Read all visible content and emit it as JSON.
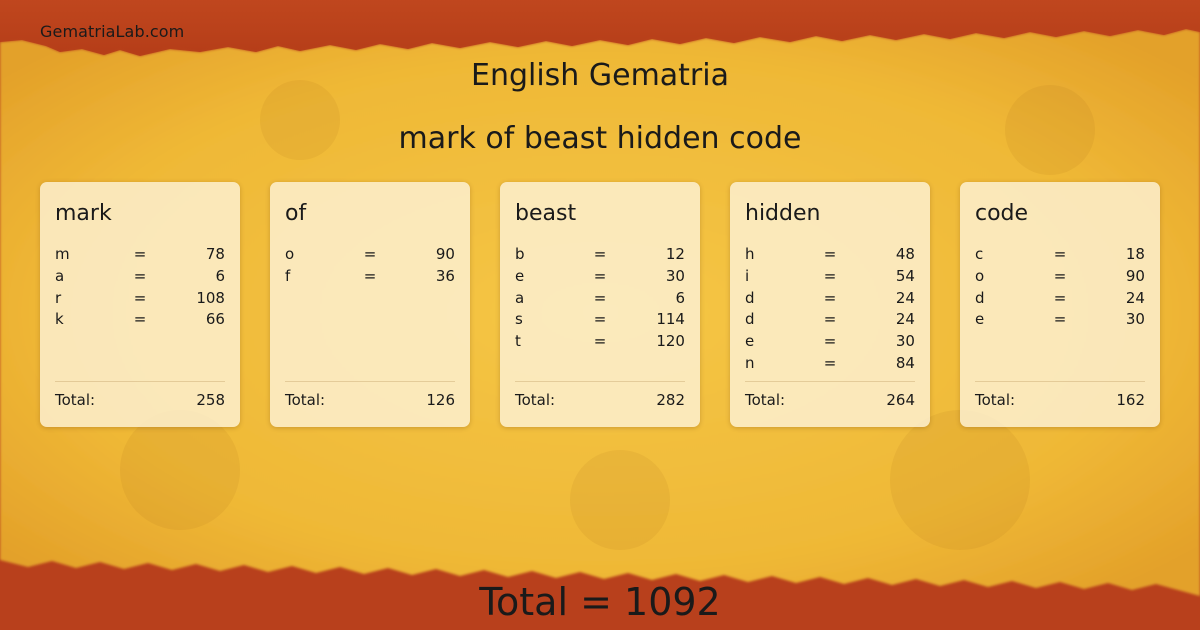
{
  "site": {
    "name": "GematriaLab.com"
  },
  "header": {
    "title": "English Gematria",
    "phrase": "mark of beast hidden code"
  },
  "labels": {
    "equals": "=",
    "total": "Total:"
  },
  "cards": [
    {
      "word": "mark",
      "letters": [
        {
          "letter": "m",
          "value": "78"
        },
        {
          "letter": "a",
          "value": "6"
        },
        {
          "letter": "r",
          "value": "108"
        },
        {
          "letter": "k",
          "value": "66"
        }
      ],
      "total": "258"
    },
    {
      "word": "of",
      "letters": [
        {
          "letter": "o",
          "value": "90"
        },
        {
          "letter": "f",
          "value": "36"
        }
      ],
      "total": "126"
    },
    {
      "word": "beast",
      "letters": [
        {
          "letter": "b",
          "value": "12"
        },
        {
          "letter": "e",
          "value": "30"
        },
        {
          "letter": "a",
          "value": "6"
        },
        {
          "letter": "s",
          "value": "114"
        },
        {
          "letter": "t",
          "value": "120"
        }
      ],
      "total": "282"
    },
    {
      "word": "hidden",
      "letters": [
        {
          "letter": "h",
          "value": "48"
        },
        {
          "letter": "i",
          "value": "54"
        },
        {
          "letter": "d",
          "value": "24"
        },
        {
          "letter": "d",
          "value": "24"
        },
        {
          "letter": "e",
          "value": "30"
        },
        {
          "letter": "n",
          "value": "84"
        }
      ],
      "total": "264"
    },
    {
      "word": "code",
      "letters": [
        {
          "letter": "c",
          "value": "18"
        },
        {
          "letter": "o",
          "value": "90"
        },
        {
          "letter": "d",
          "value": "24"
        },
        {
          "letter": "e",
          "value": "30"
        }
      ],
      "total": "162"
    }
  ],
  "grand_total": "Total = 1092",
  "colors": {
    "parchment": "#f0b93a",
    "border_red": "#b8401c",
    "card": "#fdf2d6",
    "text": "#1a1a1a"
  }
}
